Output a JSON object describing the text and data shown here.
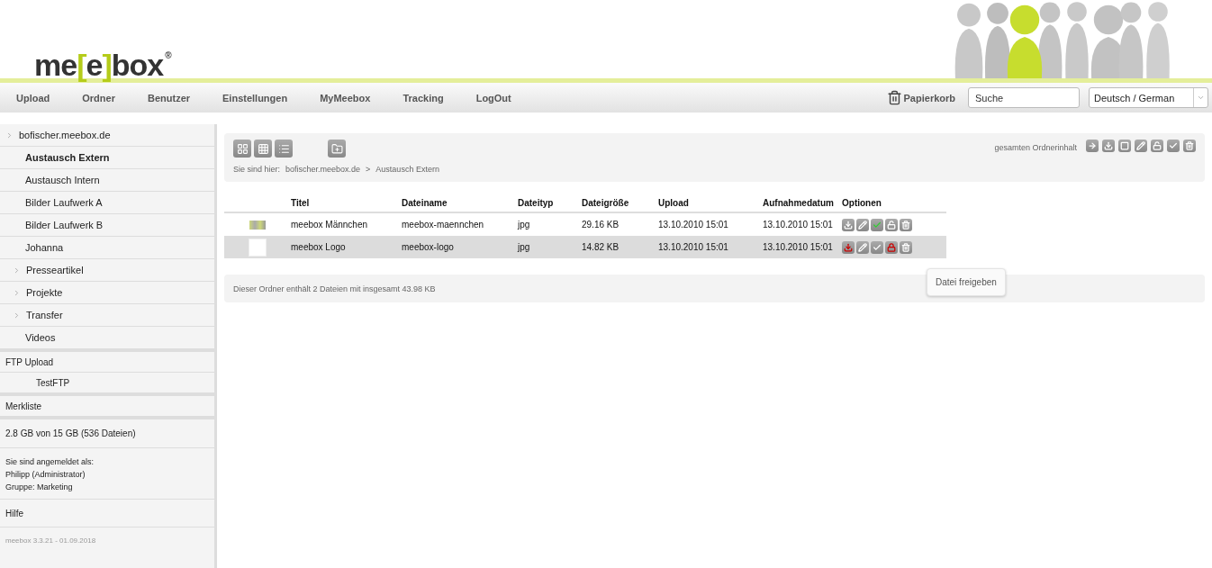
{
  "logo": {
    "before": "me",
    "open": "[",
    "inner": "e",
    "close": "]",
    "after": "box",
    "mark": "®"
  },
  "nav": {
    "items": [
      "Upload",
      "Ordner",
      "Benutzer",
      "Einstellungen",
      "MyMeebox",
      "Tracking",
      "LogOut"
    ],
    "trash": "Papierkorb",
    "search": {
      "placeholder": "Suche"
    },
    "language": "Deutsch / German"
  },
  "sidebar": {
    "tree": [
      {
        "label": "bofischer.meebox.de",
        "expandable": true,
        "selected": false,
        "children": [
          {
            "label": "Austausch Extern",
            "expandable": false,
            "selected": true
          },
          {
            "label": "Austausch Intern",
            "expandable": false,
            "selected": false
          },
          {
            "label": "Bilder Laufwerk A",
            "expandable": false,
            "selected": false
          },
          {
            "label": "Bilder Laufwerk B",
            "expandable": false,
            "selected": false
          },
          {
            "label": "Johanna",
            "expandable": false,
            "selected": false
          },
          {
            "label": "Presseartikel",
            "expandable": true,
            "selected": false
          },
          {
            "label": "Projekte",
            "expandable": true,
            "selected": false
          },
          {
            "label": "Transfer",
            "expandable": true,
            "selected": false
          },
          {
            "label": "Videos",
            "expandable": false,
            "selected": false
          }
        ]
      }
    ],
    "ftp": {
      "label": "FTP Upload",
      "items": [
        "TestFTP"
      ]
    },
    "watchlist": "Merkliste",
    "usage": "2.8 GB von 15 GB (536 Dateien)",
    "login": [
      "Sie sind angemeldet als:",
      "Philipp (Administrator)",
      "Gruppe: Marketing"
    ],
    "help": "Hilfe",
    "version": "meebox 3.3.21 - 01.09.2018"
  },
  "toolbar": {
    "views": [
      {
        "kind": "grid-large"
      },
      {
        "kind": "grid-small"
      },
      {
        "kind": "list"
      }
    ],
    "breadcrumb_label": "Sie sind hier:",
    "breadcrumb": [
      "bofischer.meebox.de",
      "Austausch Extern"
    ],
    "separator": ">",
    "folder_label": "gesamten Ordnerinhalt",
    "folder_actions": [
      {
        "kind": "move"
      },
      {
        "kind": "download"
      },
      {
        "kind": "select"
      },
      {
        "kind": "edit"
      },
      {
        "kind": "unlock"
      },
      {
        "kind": "check"
      },
      {
        "kind": "delete"
      }
    ]
  },
  "table": {
    "columns": [
      "Titel",
      "Dateiname",
      "Dateityp",
      "Dateigröße",
      "Upload",
      "Aufnahmedatum",
      "Optionen"
    ],
    "rows": [
      {
        "kind": "figures",
        "cells": [
          "meebox Männchen",
          "meebox-maennchen",
          "jpg",
          "29.16 KB",
          "13.10.2010 15:01",
          "13.10.2010 15:01"
        ],
        "selected": false,
        "options": [
          {
            "kind": "download",
            "ok": false,
            "alert": false
          },
          {
            "kind": "edit",
            "ok": false,
            "alert": false
          },
          {
            "kind": "check",
            "ok": true,
            "alert": false
          },
          {
            "kind": "unlock",
            "ok": false,
            "alert": false
          },
          {
            "kind": "delete",
            "ok": false,
            "alert": false
          }
        ]
      },
      {
        "kind": "logo",
        "cells": [
          "meebox Logo",
          "meebox-logo",
          "jpg",
          "14.82 KB",
          "13.10.2010 15:01",
          "13.10.2010 15:01"
        ],
        "selected": true,
        "options": [
          {
            "kind": "download",
            "ok": false,
            "alert": true
          },
          {
            "kind": "edit",
            "ok": false,
            "alert": false
          },
          {
            "kind": "check",
            "ok": false,
            "alert": false
          },
          {
            "kind": "lock",
            "ok": false,
            "alert": true
          },
          {
            "kind": "delete",
            "ok": false,
            "alert": false
          }
        ]
      }
    ]
  },
  "summary": "Dieser Ordner enthält 2 Dateien mit insgesamt 43.98 KB",
  "tooltip": "Datei freigeben"
}
